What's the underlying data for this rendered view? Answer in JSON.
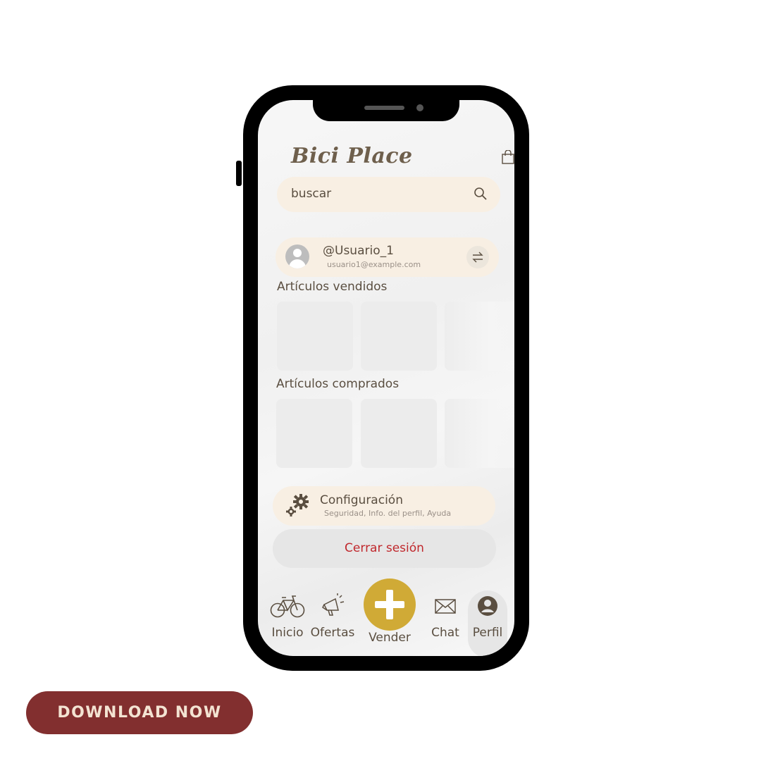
{
  "app": {
    "brand": "Bici Place",
    "search_placeholder": "buscar"
  },
  "user": {
    "username": "@Usuario_1",
    "email": "usuario1@example.com"
  },
  "sections": {
    "sold_title": "Artículos vendidos",
    "bought_title": "Artículos comprados"
  },
  "settings": {
    "title": "Configuración",
    "subtitle": "Seguridad, Info. del perfil, Ayuda"
  },
  "logout_label": "Cerrar sesión",
  "nav": {
    "home": "Inicio",
    "offers": "Ofertas",
    "sell": "Vender",
    "chat": "Chat",
    "profile": "Perfil"
  },
  "cta": "DOWNLOAD NOW",
  "colors": {
    "accent": "#d0aa36",
    "card": "#f8efe3",
    "logout_text": "#c0282d",
    "cta_bg": "#822f2f"
  }
}
